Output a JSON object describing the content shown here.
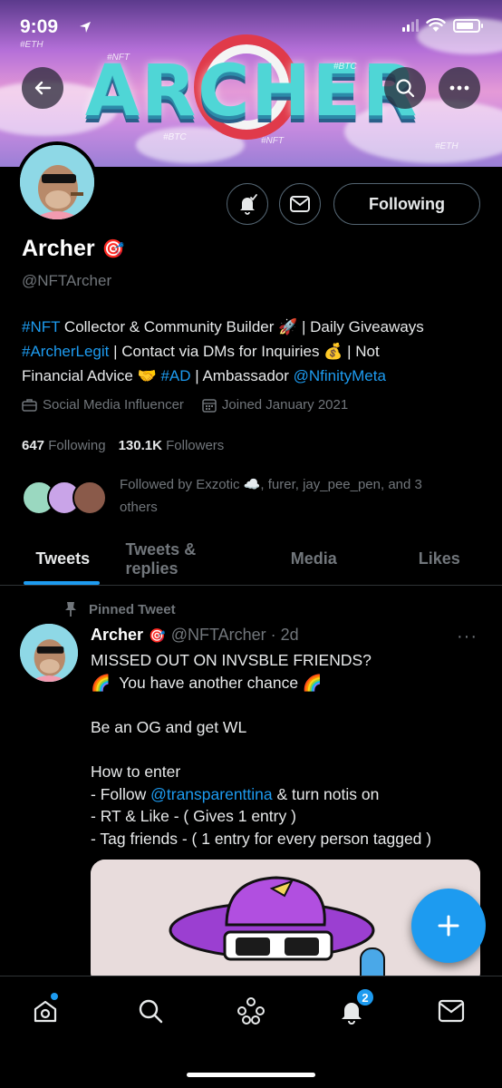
{
  "status_bar": {
    "time": "9:09"
  },
  "banner": {
    "title": "ARCHER",
    "tags": [
      "#ETH",
      "#NFT",
      "#BTC",
      "#BTC",
      "#NFT",
      "#ETH",
      "#NFT",
      "#BTC"
    ]
  },
  "profile": {
    "name": "Archer",
    "name_emoji": "🎯",
    "handle": "@NFTArcher",
    "following_button": "Following",
    "bio": {
      "line1_link": "#NFT",
      "line1_text": " Collector & Community Builder 🚀 | Daily Giveaways",
      "line2_link": "#ArcherLegit",
      "line2_text": " | Contact via DMs for Inquiries 💰 | Not",
      "line3_text": "Financial Advice 🤝 ",
      "line3_link": "#AD",
      "line3_text2": " | Ambassador ",
      "line3_link2": "@NfinityMeta"
    },
    "category": "Social Media Influencer",
    "joined": "Joined January 2021",
    "following_count": "647",
    "following_label": "Following",
    "followers_count": "130.1K",
    "followers_label": "Followers",
    "followed_by": "Followed by Exzotic ☁️, furer, jay_pee_pen, and 3 others"
  },
  "tabs": [
    {
      "label": "Tweets",
      "active": true
    },
    {
      "label": "Tweets & replies",
      "active": false
    },
    {
      "label": "Media",
      "active": false
    },
    {
      "label": "Likes",
      "active": false
    }
  ],
  "tweet": {
    "pinned_label": "Pinned Tweet",
    "name": "Archer",
    "name_emoji": "🎯",
    "handle_time": "@NFTArcher · 2d",
    "more": "···",
    "lines": [
      "MISSED OUT ON INVSBLE FRIENDS?",
      "🌈  You have another chance 🌈",
      "",
      "Be an OG and get WL",
      "",
      "How to enter"
    ],
    "follow_prefix": "- Follow ",
    "follow_link": "@transparenttina",
    "follow_suffix": " & turn notis on",
    "line_rt": "- RT & Like - ( Gives 1 entry )",
    "line_tag": "- Tag friends - ( 1 entry for every person tagged )"
  },
  "bottom_nav": {
    "notifications_badge": "2"
  },
  "colors": {
    "accent": "#1d9bf0",
    "muted": "#71767b",
    "background": "#000000",
    "border": "#2f3336"
  }
}
